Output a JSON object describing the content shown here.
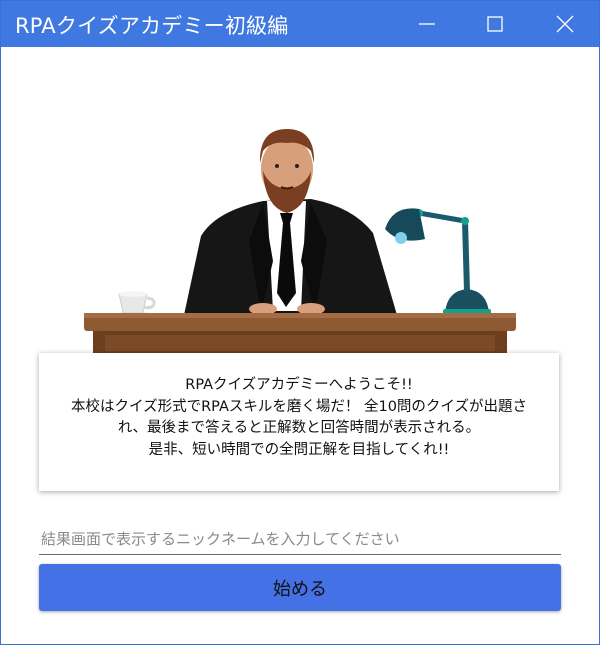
{
  "window": {
    "title": "RPAクイズアカデミー初級編",
    "controls": [
      "minimize-icon",
      "maximize-icon",
      "close-icon"
    ],
    "accent_color": "#3f78e0"
  },
  "intro": {
    "lines": [
      "RPAクイズアカデミーへようこそ!!",
      "本校はクイズ形式でRPAスキルを磨く場だ！ 全10問のクイズが出題さ",
      "れ、最後まで答えると正解数と回答時間が表示される。",
      "是非、短い時間での全問正解を目指してくれ!!"
    ]
  },
  "nickname": {
    "placeholder": "結果画面で表示するニックネームを入力してください",
    "value": ""
  },
  "start_button": {
    "label": "始める",
    "color": "#4571e6"
  },
  "illustration": {
    "icons": [
      "teacher-illustration",
      "coffee-cup-icon",
      "desk-lamp-icon",
      "desk"
    ]
  }
}
